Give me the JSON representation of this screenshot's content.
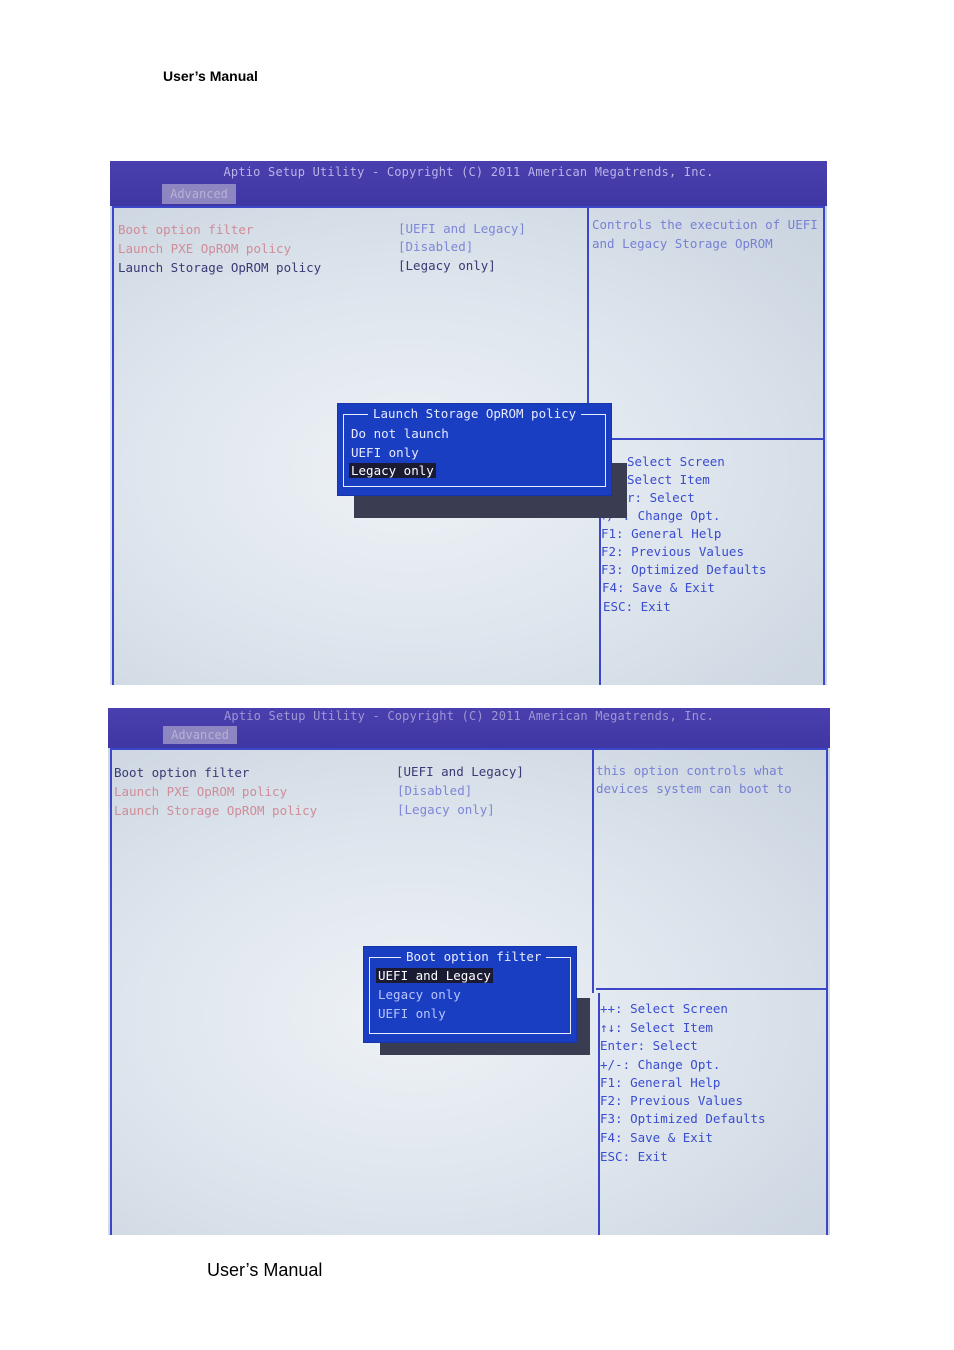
{
  "page": {
    "header": "User’s Manual",
    "footer": "User’s Manual"
  },
  "screens": [
    {
      "title": "Aptio Setup Utility - Copyright (C) 2011 American Megatrends, Inc.",
      "tab": "Advanced",
      "settings": [
        {
          "label": "Boot option filter",
          "value": "[UEFI and Legacy]"
        },
        {
          "label": "Launch PXE OpROM policy",
          "value": "[Disabled]"
        },
        {
          "label": "Launch Storage OpROM policy",
          "value": "[Legacy only]"
        }
      ],
      "help": [
        "Controls the execution of UEFI",
        "and Legacy Storage OpROM"
      ],
      "popup": {
        "title": "Launch Storage OpROM policy",
        "options": [
          "Do not launch",
          "UEFI only",
          "Legacy only"
        ],
        "selected": "Legacy only"
      },
      "keys": [
        "Select Screen",
        "Select Item",
        "r: Select",
        "+/-: Change Opt.",
        "F1: General Help",
        "F2: Previous Values",
        "F3: Optimized Defaults",
        "F4: Save & Exit",
        "ESC: Exit"
      ]
    },
    {
      "title": "Aptio Setup Utility - Copyright (C) 2011 American Megatrends, Inc.",
      "tab": "Advanced",
      "settings": [
        {
          "label": "Boot option filter",
          "value": "[UEFI and Legacy]"
        },
        {
          "label": "Launch PXE OpROM policy",
          "value": "[Disabled]"
        },
        {
          "label": "Launch Storage OpROM policy",
          "value": "[Legacy only]"
        }
      ],
      "help": [
        "this option controls what",
        "devices system can boot to"
      ],
      "popup": {
        "title": "Boot option filter",
        "options": [
          "UEFI and Legacy",
          "Legacy only",
          "UEFI only"
        ],
        "selected": "UEFI and Legacy"
      },
      "keys": [
        "++: Select Screen",
        "↑↓: Select Item",
        "Enter: Select",
        "+/-: Change Opt.",
        "F1: General Help",
        "F2: Previous Values",
        "F3: Optimized Defaults",
        "F4: Save & Exit",
        "ESC: Exit"
      ]
    }
  ]
}
